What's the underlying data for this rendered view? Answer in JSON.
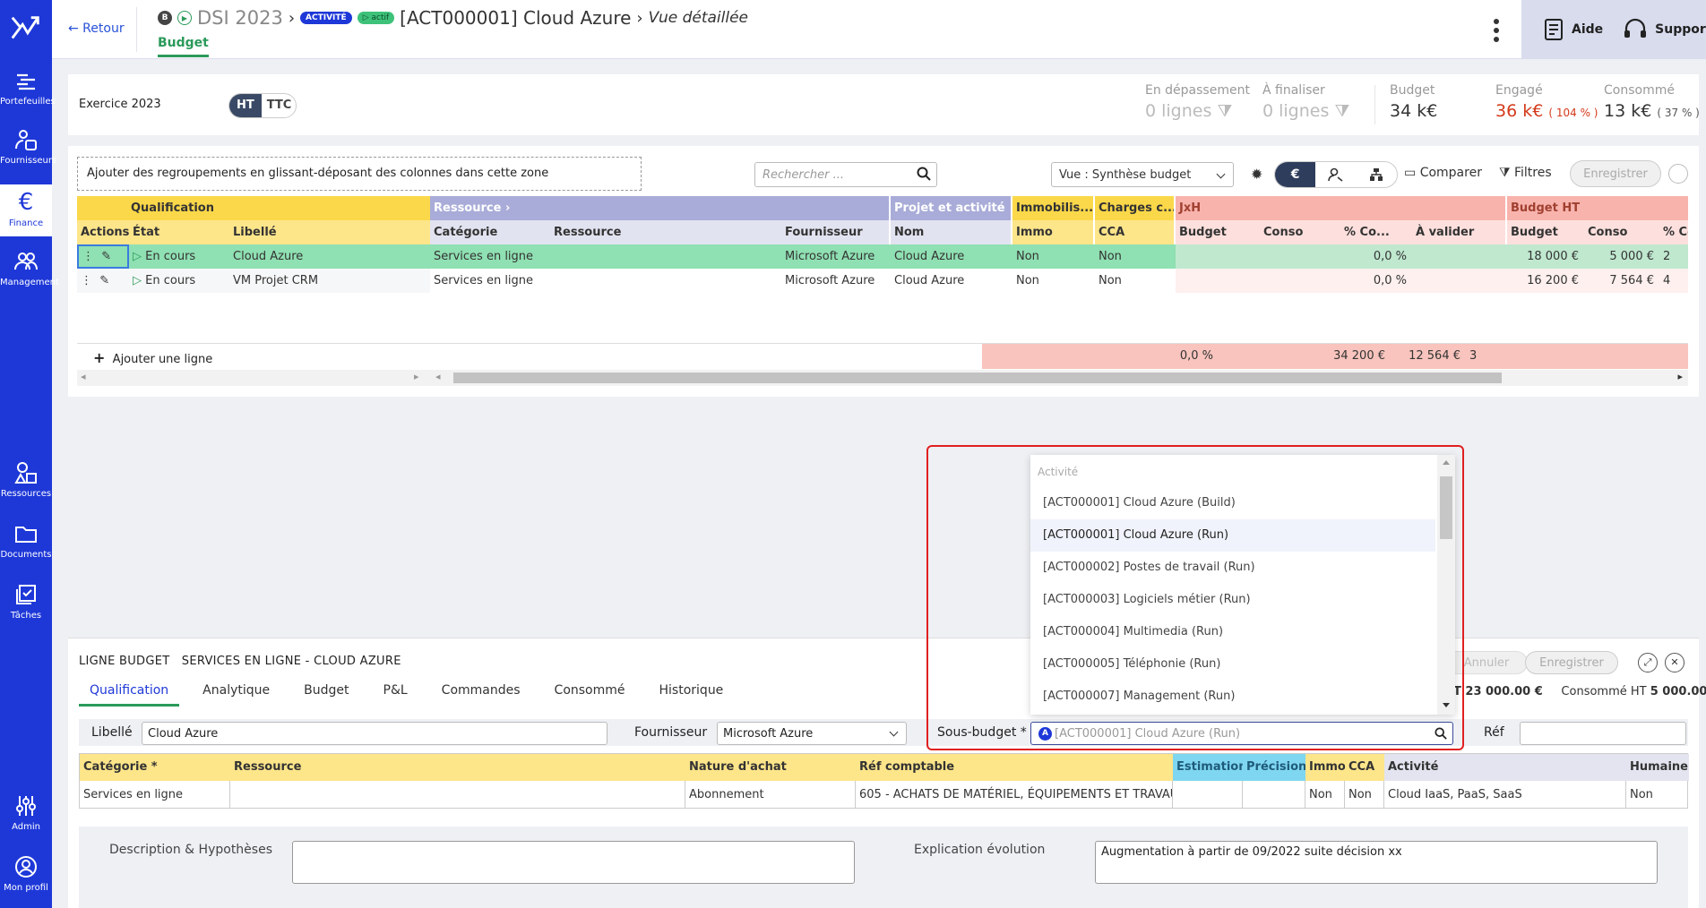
{
  "sidebar": {
    "items": [
      {
        "label": "Portefeuilles"
      },
      {
        "label": "Fournisseurs"
      },
      {
        "label": "Finance"
      },
      {
        "label": "Management"
      },
      {
        "label": "Ressources"
      },
      {
        "label": "Documents"
      },
      {
        "label": "Tâches"
      },
      {
        "label": "Admin"
      },
      {
        "label": "Mon profil"
      }
    ]
  },
  "header": {
    "back": "← Retour",
    "b_badge": "B",
    "project": "DSI 2023",
    "badge_activite": "ACTIVITÉ",
    "badge_actif": "actif",
    "title": "[ACT000001] Cloud Azure",
    "view": "Vue détaillée",
    "subtab": "Budget",
    "help": "Aide",
    "support": "Support"
  },
  "summary": {
    "exercice": "Exercice 2023",
    "ht": "HT",
    "ttc": "TTC",
    "depassement_label": "En dépassement",
    "depassement_val": "0 lignes",
    "finaliser_label": "À finaliser",
    "finaliser_val": "0 lignes",
    "budget_label": "Budget",
    "budget_val": "34 k€",
    "engage_label": "Engagé",
    "engage_val": "36 k€",
    "engage_pct": "( 104 % )",
    "consomme_label": "Consommé",
    "consomme_val": "13 k€",
    "consomme_pct": "( 37 % )"
  },
  "toolbar": {
    "dropzone": "Ajouter des regroupements en glissant-déposant des colonnes dans cette zone",
    "search_placeholder": "Rechercher ...",
    "vue": "Vue : Synthèse budget",
    "euro": "€",
    "comparer": "Comparer",
    "filtres": "Filtres",
    "enregistrer": "Enregistrer"
  },
  "grid": {
    "groups": {
      "qualification": "Qualification",
      "ressource": "Ressource",
      "projet": "Projet et activité",
      "immo": "Immobilis...",
      "charges": "Charges c...",
      "jxh": "JxH",
      "budget_ht": "Budget HT"
    },
    "headers": {
      "actions": "Actions",
      "etat": "État",
      "libelle": "Libellé",
      "categorie": "Catégorie",
      "ressource": "Ressource",
      "fournisseur": "Fournisseur",
      "nom": "Nom",
      "immo": "Immo",
      "cca": "CCA",
      "budget": "Budget",
      "conso": "Conso",
      "pct_conso": "% Co...",
      "a_valider": "À valider",
      "budget2": "Budget",
      "conso2": "Conso",
      "pct_conso2": "% Co..."
    },
    "rows": [
      {
        "etat": "En cours",
        "libelle": "Cloud Azure",
        "categorie": "Services en ligne",
        "fournisseur": "Microsoft Azure",
        "nom": "Cloud Azure",
        "immo": "Non",
        "cca": "Non",
        "pct": "0,0 %",
        "budget": "18 000 €",
        "conso": "5 000 €",
        "pct2": "2"
      },
      {
        "etat": "En cours",
        "libelle": "VM Projet CRM",
        "categorie": "Services en ligne",
        "fournisseur": "Microsoft Azure",
        "nom": "Cloud Azure",
        "immo": "Non",
        "cca": "Non",
        "pct": "0,0 %",
        "budget": "16 200 €",
        "conso": "7 564 €",
        "pct2": "4"
      }
    ],
    "add_line": "Ajouter une ligne",
    "totals": {
      "pct": "0,0 %",
      "budget": "34 200 €",
      "conso": "12 564 €",
      "pct2": "3"
    }
  },
  "detail": {
    "title": "LIGNE BUDGET   SERVICES EN LIGNE - CLOUD AZURE",
    "tabs": [
      "Qualification",
      "Analytique",
      "Budget",
      "P&L",
      "Commandes",
      "Consommé",
      "Historique"
    ],
    "annuler": "Annuler",
    "enregistrer": "Enregistrer",
    "total_budget": "T 23 000.00 €",
    "consomme_ht_label": "Consommé HT",
    "consomme_ht": "5 000.00 €",
    "libelle_label": "Libellé",
    "libelle_value": "Cloud Azure",
    "fournisseur_label": "Fournisseur",
    "fournisseur_value": "Microsoft Azure",
    "sousbudget_label": "Sous-budget *",
    "sousbudget_value": "[ACT000001] Cloud Azure (Run)",
    "ref_label": "Réf",
    "table_headers": [
      "Catégorie *",
      "Ressource",
      "Nature d'achat",
      "Réf comptable",
      "Estimation",
      "Précision",
      "Immo",
      "CCA",
      "Activité",
      "Humaine"
    ],
    "table_values": [
      "Services en ligne",
      "",
      "Abonnement",
      "605 - ACHATS DE MATÉRIEL, ÉQUIPEMENTS ET TRAVAUX",
      "",
      "",
      "Non",
      "Non",
      "Cloud IaaS, PaaS, SaaS",
      "Non"
    ],
    "desc_label": "Description & Hypothèses",
    "explication_label": "Explication évolution",
    "explication_value": "Augmentation à partir de 09/2022 suite décision xx"
  },
  "dropdown": {
    "group_label": "Activité",
    "options": [
      "[ACT000001] Cloud Azure (Build)",
      "[ACT000001] Cloud Azure (Run)",
      "[ACT000002] Postes de travail (Run)",
      "[ACT000003] Logiciels métier (Run)",
      "[ACT000004] Multimedia (Run)",
      "[ACT000005] Téléphonie (Run)",
      "[ACT000007] Management (Run)"
    ]
  }
}
